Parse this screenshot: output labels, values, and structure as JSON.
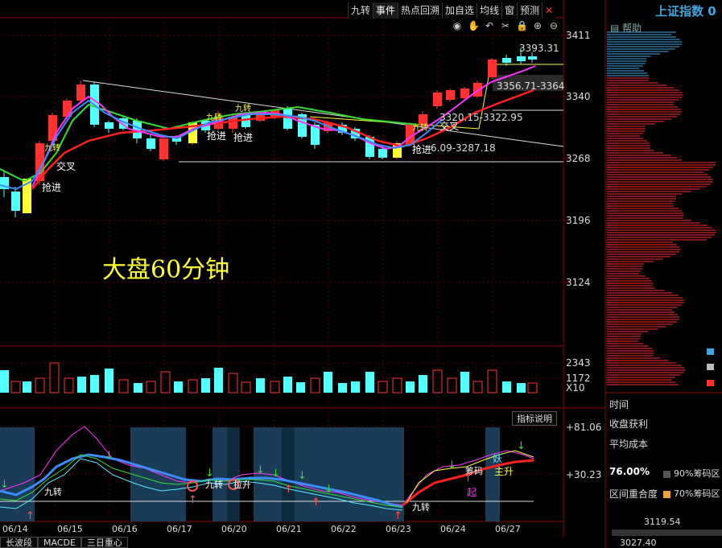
{
  "toolbar": {
    "items": [
      "九转",
      "事件",
      "热点回溯",
      "加自选",
      "均线",
      "窗",
      "预测"
    ],
    "close_icon": "close-icon"
  },
  "tool_icons": [
    "eye-icon",
    "hand-icon",
    "undo-icon",
    "scissors-icon",
    "lock-icon",
    "zoom-in-icon",
    "zoom-out-icon"
  ],
  "main": {
    "title": "大盘60分钟",
    "price_axis": [
      "3411",
      "3340",
      "3268",
      "3196",
      "3124"
    ],
    "annotations": {
      "high": "3393.31",
      "range1": "3356.71-3364",
      "range2": "3320.15-3322.95",
      "range3": "6.09-3287.18",
      "signal_buy1": "抢进",
      "signal_buy2": "抢进",
      "signal_buy3": "抢进",
      "signal_buy4": "抢进",
      "cross1": "交叉",
      "cross2": "交叉",
      "turn1": "九转",
      "turn2": "九转",
      "turn3": "九转",
      "turn4": "九转"
    }
  },
  "volume": {
    "axis": [
      "2343",
      "1172",
      "X10"
    ]
  },
  "indicator": {
    "button": "指标说明",
    "axis": [
      "+81.06",
      "+30.23"
    ],
    "labels": {
      "turn_a": "九转",
      "turn_b": "九转",
      "turn_c": "九转",
      "up": "起",
      "rise": "主升",
      "demon": "妖",
      "chip": "筹码",
      "pickup": "拉升"
    }
  },
  "dates": [
    "06/14",
    "06/15",
    "06/16",
    "06/17",
    "06/20",
    "06/21",
    "06/22",
    "06/23",
    "06/24",
    "06/27"
  ],
  "bottom_tabs": [
    "长波段",
    "MACDE",
    "三日重心"
  ],
  "right_panel": {
    "title": "上证指数 0",
    "help": "帮助",
    "time_label": "时间",
    "profit_label": "收盘获利",
    "cost_label": "平均成本",
    "pct": "76.00%",
    "chip90": "90%筹码区",
    "overlap_label": "区间重合度",
    "chip70": "70%筹码区",
    "price1": "3119.54",
    "price2": "3027.40"
  },
  "colors": {
    "up": "#ff3232",
    "down": "#54ffff",
    "ma_red": "#ff2020",
    "ma_magenta": "#ff33ff",
    "ma_green": "#33dd33",
    "ma_blue": "#3b8cff",
    "title_yellow": "#ffff33"
  }
}
